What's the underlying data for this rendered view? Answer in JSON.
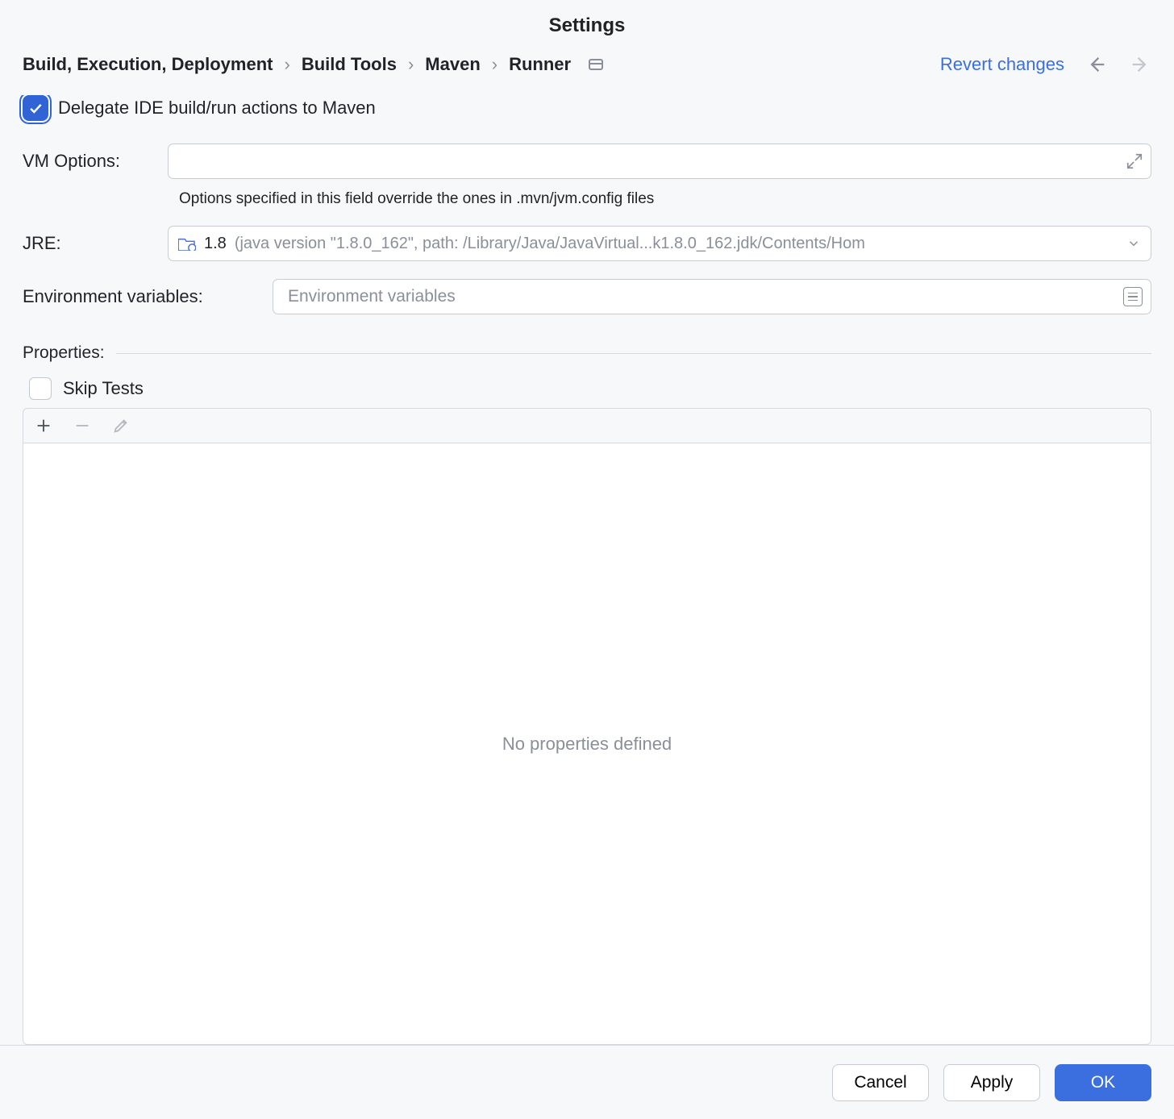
{
  "title": "Settings",
  "breadcrumb": {
    "item0": "Build, Execution, Deployment",
    "item1": "Build Tools",
    "item2": "Maven",
    "item3": "Runner"
  },
  "actions": {
    "revert": "Revert changes"
  },
  "delegate": {
    "label": "Delegate IDE build/run actions to Maven",
    "checked": true
  },
  "vm_options": {
    "label": "VM Options:",
    "value": "",
    "hint": "Options specified in this field override the ones in .mvn/jvm.config files"
  },
  "jre": {
    "label": "JRE:",
    "version": "1.8",
    "detail": "(java version \"1.8.0_162\", path: /Library/Java/JavaVirtual...k1.8.0_162.jdk/Contents/Hom"
  },
  "env": {
    "label": "Environment variables:",
    "placeholder": "Environment variables"
  },
  "properties": {
    "section_label": "Properties:",
    "skip_tests_label": "Skip Tests",
    "skip_tests_checked": false,
    "empty_text": "No properties defined"
  },
  "footer": {
    "cancel": "Cancel",
    "apply": "Apply",
    "ok": "OK"
  }
}
